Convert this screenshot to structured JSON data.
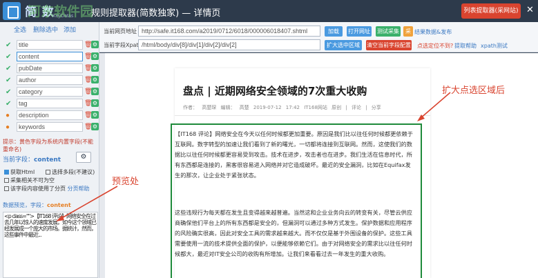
{
  "header": {
    "brand": "简 数",
    "brand_sub": "KeyDatas",
    "title": "规则提取器(简数独家) — 详情页",
    "watermark": "河东软件园",
    "publish_button": "列表提取器(采网站)",
    "close": "✕"
  },
  "left_panel": {
    "toolbar": [
      "全选",
      "删除选中",
      "添加"
    ],
    "fields": [
      {
        "name": "title",
        "status": "ok",
        "selected": false
      },
      {
        "name": "content",
        "status": "ok",
        "selected": true
      },
      {
        "name": "pubDate",
        "status": "ok",
        "selected": false
      },
      {
        "name": "author",
        "status": "ok",
        "selected": false
      },
      {
        "name": "category",
        "status": "ok",
        "selected": false
      },
      {
        "name": "tag",
        "status": "ok",
        "selected": false
      },
      {
        "name": "description",
        "status": "warn",
        "selected": false
      },
      {
        "name": "keywords",
        "status": "warn",
        "selected": false
      }
    ],
    "field_note": "提示：黄色字段为系统内置字段(不能重命名)",
    "current_field_label": "当前字段：",
    "current_field_value": "content",
    "options": [
      {
        "label": "获取Html",
        "checked": true
      },
      {
        "label": "选择多段(不建议)",
        "checked": false
      },
      {
        "label": "采集相关不可为空",
        "checked": false
      },
      {
        "label": "该字段内容使用了分页",
        "checked": false
      }
    ],
    "pagination_help": "分页帮助",
    "preview_label": "数据预览，字段：",
    "preview_field": "content",
    "preview_text": "<p class=\"\">【IT168 评论】网络安全在过去几年以惊人的速度发展，如今这个领域已经发展成一个庞大的市场。据统计，然而，这些事件中最近..."
  },
  "toolbar": {
    "url_label": "当前网页地址",
    "url_value": "http://safe.it168.com/a2019/0712/6018/000006018407.shtml",
    "xpath_label": "当前字段Xpath",
    "xpath_value": "/html/body/div[8]/div[1]/div[2]/div[2]",
    "row1_buttons": [
      {
        "label": "加载",
        "color": "#4a9ae0"
      },
      {
        "label": "打开网址",
        "color": "#4a9ae0"
      },
      {
        "label": "测试采集",
        "color": "#3ab06b"
      },
      {
        "label": "采集",
        "color": "#f0a23b"
      }
    ],
    "row1_link": "结果数据&发布",
    "row2_buttons": [
      {
        "label": "扩大选中区域",
        "color": "#4a9ae0"
      },
      {
        "label": "清空当前字段配置",
        "color": "#d9442f"
      }
    ],
    "row2_links": [
      "点选定位不到?",
      "提取帮助",
      "xpath测试"
    ]
  },
  "article": {
    "title": "盘点 | 近期网络安全领域的7次重大收购",
    "meta": "作者： 高楚琛  编辑： 高楚  2019-07-12 17:42  IT168网站 原创 | 评论 | 分享",
    "paragraphs": [
      "【IT168 评论】网络安全在今天以任何时候都更加重要。原因是我们比以往任何时候都更依赖于互联网。数字转型的加速让我们看到了新的曙光，一切都将连接到互联网。然而，这使我们的数据比以往任何时候都更容易受到攻击。技术在进步，攻击者也在进步。我们生活在信息时代，所有东西都是连接的，黑客很容易进入网络并对它造成破坏。最近的安全漏洞，比如在Equifax发生的那次，让企业处于紧张状态。",
      "这些违规行为每天都在发生且变得越来越普遍。当然这和企业业务向云的转变有关，尽管云供应商确保他们平台上的所有东西都是安全的，但漏洞可以通过多种方式发生。保护数据和应用程序的风险确实很高，因此对安全工具的需求越来越大。而不仅仅是基于外围设备的保护。这些工具需要使用一流的技术提供全面的保护，以便能够依赖它们。由于对网络安全的需求比以往任何时候都大，最近对IT安全公司的收购有所增加。让我们来看看过去一年发生的重大收购。"
    ]
  },
  "annotations": {
    "expand": "扩大点选区域后",
    "preview": "预览处"
  },
  "colors": {
    "header_bg": "#2d3a4b",
    "highlight_border": "#1e8a3a",
    "annotation": "#d9442f"
  }
}
